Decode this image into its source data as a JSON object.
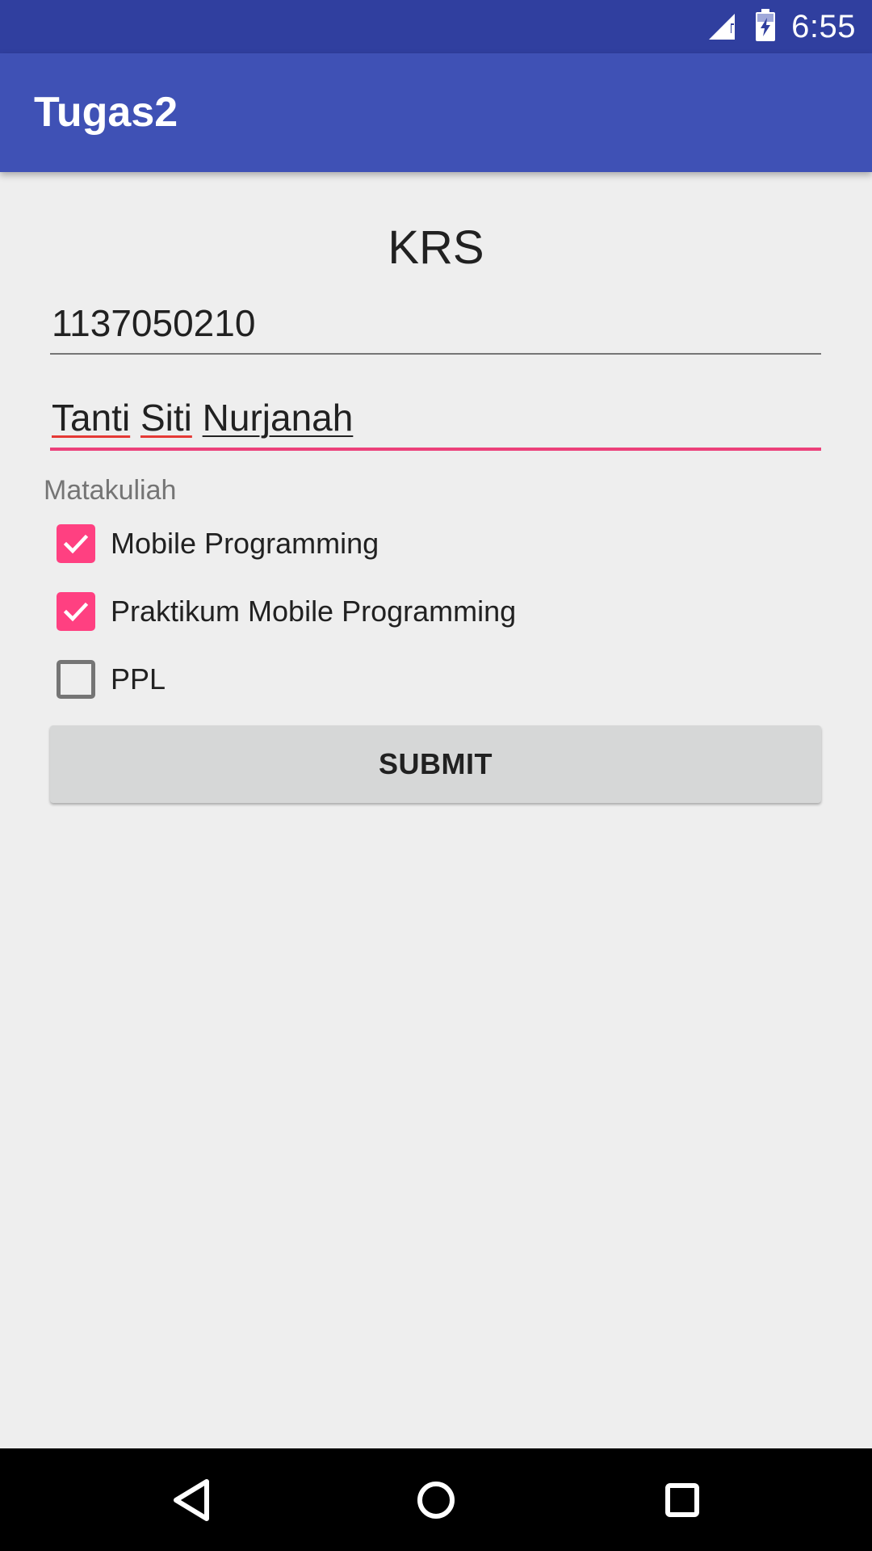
{
  "status_bar": {
    "time": "6:55",
    "icons": [
      "signal-icon",
      "battery-charging-icon"
    ]
  },
  "app_bar": {
    "title": "Tugas2"
  },
  "form": {
    "heading": "KRS",
    "nim_value": "1137050210",
    "name_words": [
      "Tanti",
      "Siti",
      "Nurjanah"
    ],
    "section_label": "Matakuliah",
    "courses": [
      {
        "label": "Mobile Programming",
        "checked": true
      },
      {
        "label": "Praktikum Mobile Programming",
        "checked": true
      },
      {
        "label": "PPL",
        "checked": false
      }
    ],
    "submit_label": "SUBMIT"
  },
  "nav_bar": {
    "buttons": [
      "back-icon",
      "home-icon",
      "recents-icon"
    ]
  },
  "colors": {
    "status_bar": "#303f9f",
    "app_bar": "#3f51b5",
    "accent": "#ff4081",
    "focused_underline": "#ec407a",
    "background": "#eeeeee"
  }
}
